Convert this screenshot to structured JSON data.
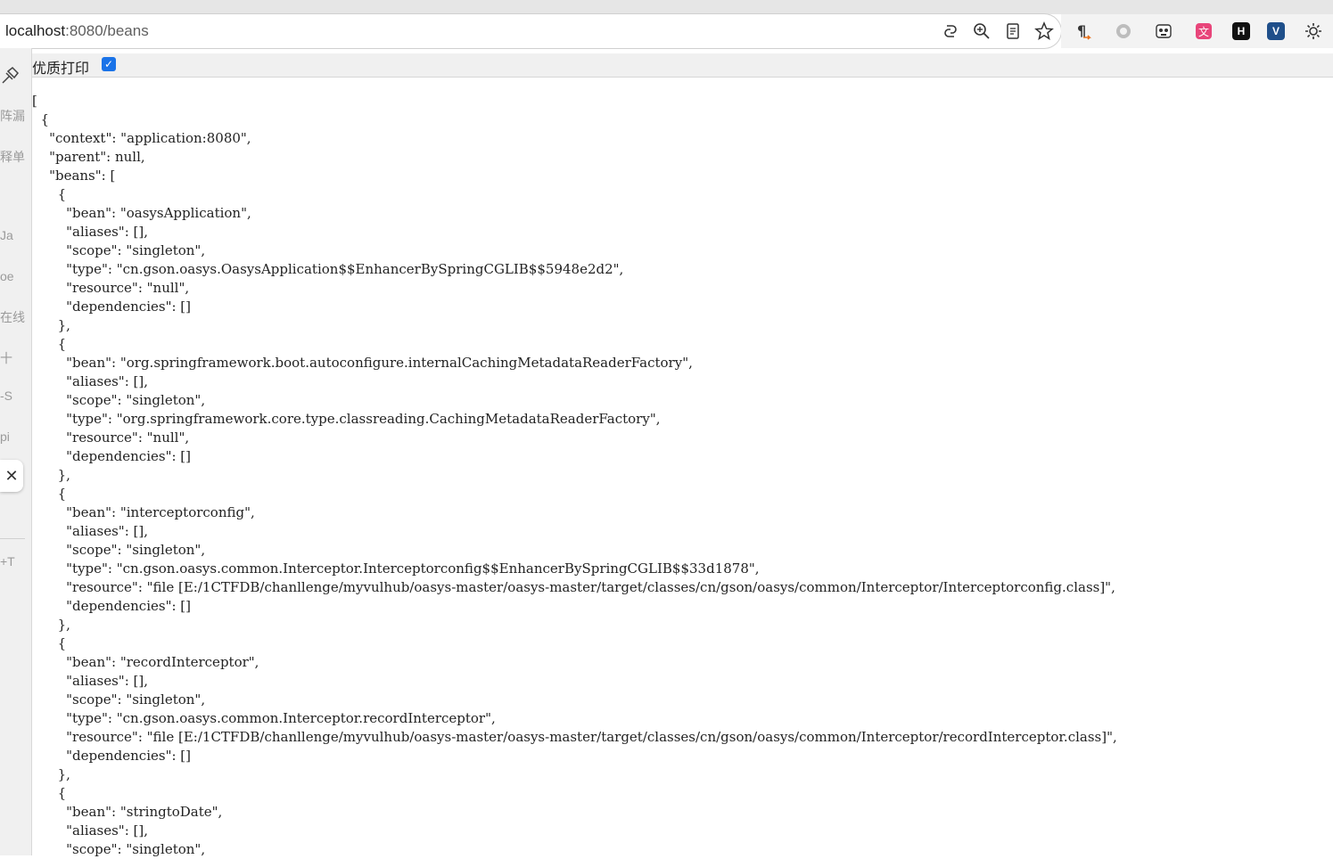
{
  "browser": {
    "url_host": "localhost",
    "url_path": ":8080/beans",
    "address_icons": [
      "copilot-icon",
      "zoom-icon",
      "reader-mode-icon",
      "favorite-star-icon"
    ],
    "extensions": [
      "pilcrow-extension-icon",
      "circle-extension-icon",
      "panda-extension-icon",
      "translate-extension-icon",
      "h-extension-icon",
      "v-extension-icon",
      "settings-extension-icon"
    ],
    "ext_h_label": "H",
    "ext_v_label": "V"
  },
  "sidebar": {
    "items": [
      "阵漏",
      "释单",
      "Ja",
      "oe",
      "在线",
      "十",
      "-S",
      "pi",
      "+T"
    ],
    "close_label": "✕"
  },
  "pretty_print": {
    "label": "优质打印",
    "checked": true
  },
  "json_lines": [
    "[",
    "  {",
    "    \"context\": \"application:8080\",",
    "    \"parent\": null,",
    "    \"beans\": [",
    "      {",
    "        \"bean\": \"oasysApplication\",",
    "        \"aliases\": [],",
    "        \"scope\": \"singleton\",",
    "        \"type\": \"cn.gson.oasys.OasysApplication$$EnhancerBySpringCGLIB$$5948e2d2\",",
    "        \"resource\": \"null\",",
    "        \"dependencies\": []",
    "      },",
    "      {",
    "        \"bean\": \"org.springframework.boot.autoconfigure.internalCachingMetadataReaderFactory\",",
    "        \"aliases\": [],",
    "        \"scope\": \"singleton\",",
    "        \"type\": \"org.springframework.core.type.classreading.CachingMetadataReaderFactory\",",
    "        \"resource\": \"null\",",
    "        \"dependencies\": []",
    "      },",
    "      {",
    "        \"bean\": \"interceptorconfig\",",
    "        \"aliases\": [],",
    "        \"scope\": \"singleton\",",
    "        \"type\": \"cn.gson.oasys.common.Interceptor.Interceptorconfig$$EnhancerBySpringCGLIB$$33d1878\",",
    "        \"resource\": \"file [E:/1CTFDB/chanllenge/myvulhub/oasys-master/oasys-master/target/classes/cn/gson/oasys/common/Interceptor/Interceptorconfig.class]\",",
    "        \"dependencies\": []",
    "      },",
    "      {",
    "        \"bean\": \"recordInterceptor\",",
    "        \"aliases\": [],",
    "        \"scope\": \"singleton\",",
    "        \"type\": \"cn.gson.oasys.common.Interceptor.recordInterceptor\",",
    "        \"resource\": \"file [E:/1CTFDB/chanllenge/myvulhub/oasys-master/oasys-master/target/classes/cn/gson/oasys/common/Interceptor/recordInterceptor.class]\",",
    "        \"dependencies\": []",
    "      },",
    "      {",
    "        \"bean\": \"stringtoDate\",",
    "        \"aliases\": [],",
    "        \"scope\": \"singleton\","
  ]
}
